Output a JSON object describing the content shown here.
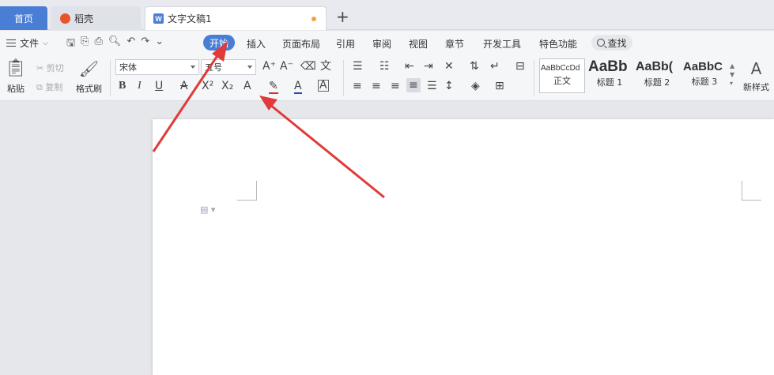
{
  "tabs": {
    "home": "首页",
    "daoke": "稻壳",
    "document": "文字文稿1",
    "new_tab": "+"
  },
  "menubar": {
    "file": "文件",
    "items": [
      "开始",
      "插入",
      "页面布局",
      "引用",
      "审阅",
      "视图",
      "章节",
      "开发工具",
      "特色功能"
    ],
    "active_index": 0,
    "search": "查找"
  },
  "ribbon": {
    "paste": "粘贴",
    "cut": "剪切",
    "copy": "复制",
    "format_painter": "格式刷",
    "font_name": "宋体",
    "font_size": "五号",
    "new_style": "新样式",
    "styles": [
      {
        "sample": "AaBbCcDd",
        "label": "正文"
      },
      {
        "sample": "AaBb",
        "label": "标题 1"
      },
      {
        "sample": "AaBb(",
        "label": "标题 2"
      },
      {
        "sample": "AaBbC",
        "label": "标题 3"
      }
    ]
  },
  "colors": {
    "accent": "#4a7ed4",
    "arrow": "#e03a3a"
  },
  "icons": {
    "bold": "B",
    "italic": "I",
    "underline": "U",
    "strike": "A",
    "superscript": "X²",
    "subscript": "X₂",
    "text_effect": "A",
    "highlight": "✎",
    "font_color": "A",
    "char_border": "A"
  }
}
